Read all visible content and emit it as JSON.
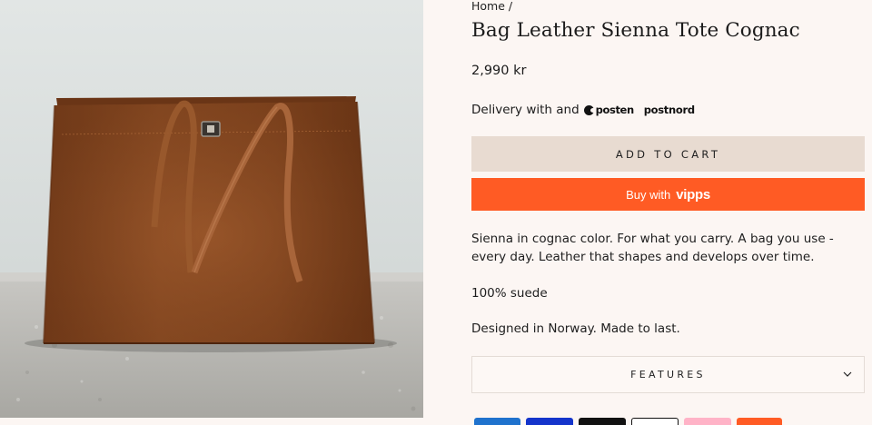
{
  "image": {
    "alt_name": "product-photo-tote"
  },
  "breadcrumb": {
    "home": "Home",
    "separator": "/"
  },
  "product": {
    "title": "Bag Leather Sienna Tote Cognac",
    "price": "2,990 kr"
  },
  "delivery": {
    "text": "Delivery with and",
    "carrier_1": "posten",
    "carrier_2": "postnord"
  },
  "buttons": {
    "add_to_cart": "ADD TO CART",
    "buy_with": "Buy with",
    "vipps": "vipps"
  },
  "description": {
    "line_1": "Sienna in cognac color. For what you carry. A bag you use - every day. Leather that shapes and develops over time.",
    "line_2": "100% suede",
    "line_3": "Designed in Norway. Made to last."
  },
  "features": {
    "label": "FEATURES",
    "icon": "chevron-down-icon"
  },
  "payment_methods": [
    "amex-icon",
    "visa-icon",
    "mastercard-icon",
    "apple-pay-icon",
    "klarna-icon",
    "vipps-icon"
  ],
  "colors": {
    "background": "#fcf6f3",
    "add_to_cart_bg": "#e8dbd1",
    "vipps_orange": "#ff5b24",
    "bag_cognac": "#8a4a22"
  }
}
